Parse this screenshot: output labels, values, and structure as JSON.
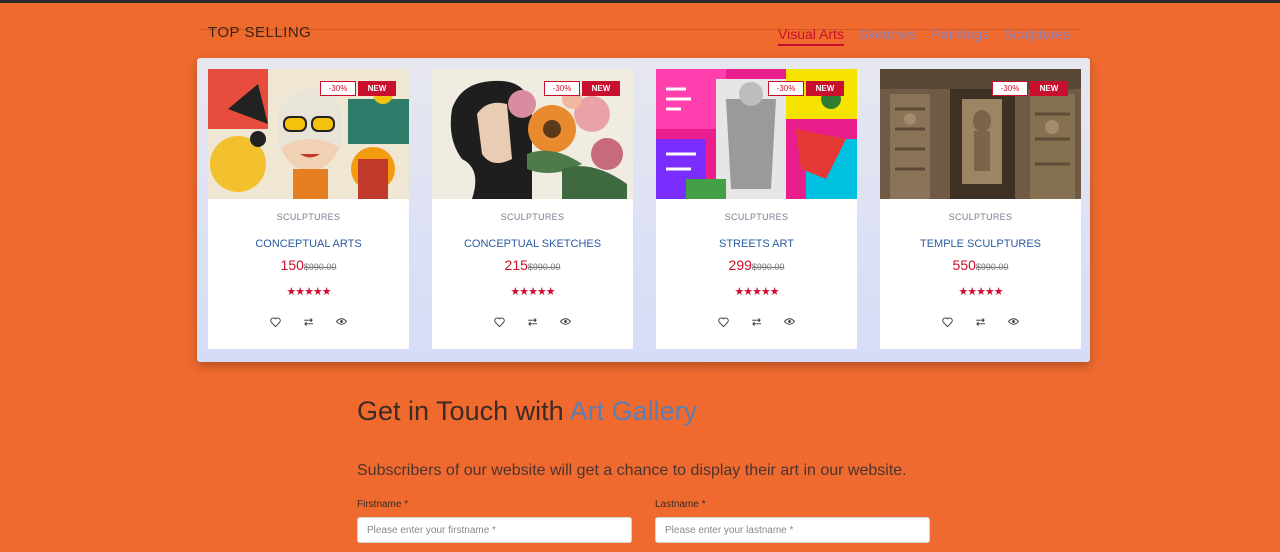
{
  "section": {
    "title": "TOP SELLING"
  },
  "tabs": [
    {
      "label": "Visual Arts",
      "active": true
    },
    {
      "label": "Sketches"
    },
    {
      "label": "Paintings"
    },
    {
      "label": "Sculptures"
    }
  ],
  "products": [
    {
      "category": "SCULPTURES",
      "name": "CONCEPTUAL ARTS",
      "price": "150",
      "old_price": "$990.00",
      "discount": "-30%",
      "badge": "NEW",
      "stars": "★★★★★"
    },
    {
      "category": "SCULPTURES",
      "name": "CONCEPTUAL SKETCHES",
      "price": "215",
      "old_price": "$990.00",
      "discount": "-30%",
      "badge": "NEW",
      "stars": "★★★★★"
    },
    {
      "category": "SCULPTURES",
      "name": "STREETS ART",
      "price": "299",
      "old_price": "$990.00",
      "discount": "-30%",
      "badge": "NEW",
      "stars": "★★★★★"
    },
    {
      "category": "SCULPTURES",
      "name": "TEMPLE SCULPTURES",
      "price": "550",
      "old_price": "$990.00",
      "discount": "-30%",
      "badge": "NEW",
      "stars": "★★★★★"
    }
  ],
  "contact": {
    "title_main": "Get in Touch with ",
    "title_accent": "Art Gallery",
    "subtitle": "Subscribers of our website will get a chance to display their art in our website.",
    "firstname_label": "Firstname *",
    "firstname_placeholder": "Please enter your firstname *",
    "lastname_label": "Lastname *",
    "lastname_placeholder": "Please enter your lastname *"
  },
  "colors": {
    "accent": "#c8102e",
    "link": "#2a5aa0",
    "background": "#ef6a2c"
  },
  "icons": [
    "heart-icon",
    "compare-icon",
    "eye-icon"
  ]
}
